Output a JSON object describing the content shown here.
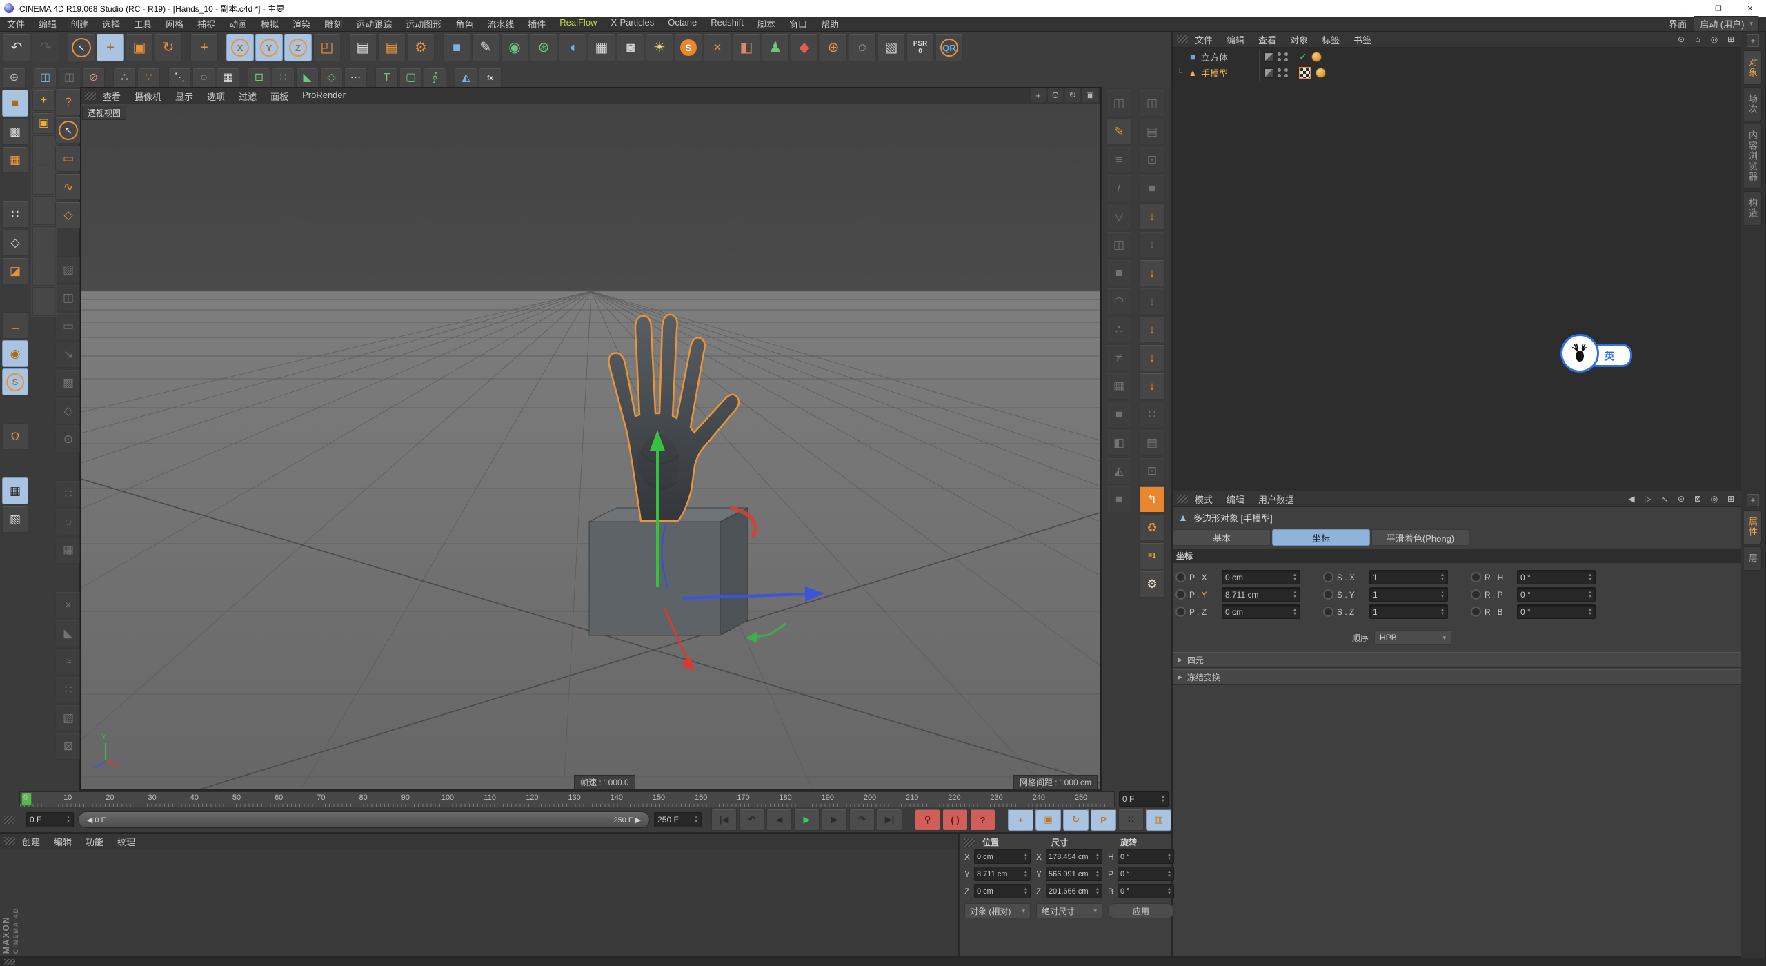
{
  "window": {
    "title": "CINEMA 4D R19.068 Studio (RC - R19) - [Hands_10 - 副本.c4d *] - 主要",
    "controls": [
      {
        "n": "minimize-button",
        "g": "─"
      },
      {
        "n": "maximize-button",
        "g": "❐"
      },
      {
        "n": "close-button",
        "g": "✕"
      }
    ]
  },
  "menubar": {
    "items": [
      "文件",
      "编辑",
      "创建",
      "选择",
      "工具",
      "网格",
      "捕捉",
      "动画",
      "模拟",
      "渲染",
      "雕刻",
      "运动跟踪",
      "运动图形",
      "角色",
      "流水线",
      "插件",
      "RealFlow",
      "X-Particles",
      "Octane",
      "Redshift",
      "脚本",
      "窗口",
      "帮助"
    ],
    "active": "RealFlow",
    "right_label": "界面",
    "layout_dropdown": "启动 (用户)",
    "accent_realflow": "#c8d94a"
  },
  "toolbar_main": [
    {
      "n": "undo-icon",
      "g": "↶",
      "c": "#d8d8d8"
    },
    {
      "n": "redo-icon",
      "g": "↷",
      "c": "#9a9a9a",
      "s": "dis"
    },
    {
      "sep": true
    },
    {
      "n": "live-selection-icon",
      "g": "↖",
      "c": "#e8e8e8",
      "s": "ring"
    },
    {
      "n": "move-tool-icon",
      "g": "+",
      "c": "#b06a10",
      "s": "active"
    },
    {
      "n": "scale-tool-icon",
      "g": "▣",
      "c": "#e8933c"
    },
    {
      "n": "rotate-tool-icon",
      "g": "↻",
      "c": "#e8933c"
    },
    {
      "sep": true
    },
    {
      "n": "last-tool-move-icon",
      "g": "+",
      "c": "#e8933c"
    },
    {
      "sep": true
    },
    {
      "n": "lock-x-axis-icon",
      "g": "X",
      "s": "circ active"
    },
    {
      "n": "lock-y-axis-icon",
      "g": "Y",
      "s": "circ active"
    },
    {
      "n": "lock-z-axis-icon",
      "g": "Z",
      "s": "circ active"
    },
    {
      "n": "coordinate-system-icon",
      "g": "◰",
      "c": "#e8933c"
    },
    {
      "sep": true
    },
    {
      "n": "render-view-icon",
      "g": "▤",
      "c": "#d8d8d8"
    },
    {
      "n": "render-picture-viewer-icon",
      "g": "▤",
      "c": "#e8933c"
    },
    {
      "n": "render-settings-icon",
      "g": "⚙",
      "c": "#e8933c"
    },
    {
      "sep": true
    },
    {
      "n": "primitive-cube-icon",
      "g": "■",
      "c": "#7db2e8"
    },
    {
      "n": "pen-spline-icon",
      "g": "✎",
      "c": "#d8d8d8"
    },
    {
      "n": "subdivision-surface-icon",
      "g": "◉",
      "c": "#6ec47a"
    },
    {
      "n": "cloner-icon",
      "g": "⊛",
      "c": "#6ec47a"
    },
    {
      "n": "spline-deformer-icon",
      "g": "◖",
      "c": "#7db2e8"
    },
    {
      "n": "floor-object-icon",
      "g": "▦",
      "c": "#cfcfcf"
    },
    {
      "n": "camera-object-icon",
      "g": "◙",
      "c": "#d0d0d0"
    },
    {
      "n": "light-object-icon",
      "g": "☀",
      "c": "#f0d070"
    },
    {
      "n": "sky-object-icon",
      "g": "S",
      "s": "orb"
    },
    {
      "n": "particle-emitter-icon",
      "g": "×",
      "c": "#e8933c"
    },
    {
      "n": "motion-clip-icon",
      "g": "◧",
      "c": "#d88a6a"
    },
    {
      "n": "character-object-icon",
      "g": "♟",
      "c": "#6ec47a"
    },
    {
      "n": "joint-tool-icon",
      "g": "◆",
      "c": "#e05d50"
    },
    {
      "n": "geo-sphere-icon",
      "g": "⊕",
      "c": "#e8933c"
    },
    {
      "n": "selection-filter-icon",
      "g": "◌",
      "c": "#cfcfcf"
    },
    {
      "n": "annotation-icon",
      "g": "▧",
      "c": "#cfcfcf"
    },
    {
      "n": "reset-psr-button",
      "g": "PSR\n0",
      "s": "txt"
    },
    {
      "n": "qr-plugin-icon",
      "g": "QR",
      "c": "#7db2e8",
      "s": "circ"
    }
  ],
  "toolbar_second": [
    {
      "n": "earth-icon",
      "g": "⊕",
      "c": "#b8b8b8"
    },
    {
      "sep": true
    },
    {
      "n": "array-axis-icon",
      "g": "◫",
      "c": "#7db2e8"
    },
    {
      "n": "array-axis-disabled-icon",
      "g": "◫",
      "s": "dis"
    },
    {
      "n": "symmetry-points-icon",
      "g": "⊘",
      "c": "#d8907a"
    },
    {
      "sep": true
    },
    {
      "n": "arc-points-icon",
      "g": "∴",
      "c": "#d8d8d8"
    },
    {
      "n": "brush-points-icon",
      "g": "∵",
      "c": "#e8933c"
    },
    {
      "sep": true
    },
    {
      "n": "spline-points-icon",
      "g": "⋱",
      "c": "#d8d8d8"
    },
    {
      "n": "circle-points-icon",
      "g": "◌",
      "c": "#d8d8d8"
    },
    {
      "n": "grid-points-icon",
      "g": "▦",
      "c": "#d8d8d8"
    },
    {
      "sep": true
    },
    {
      "n": "lattice-icon",
      "g": "⊡",
      "c": "#6ec47a"
    },
    {
      "n": "cluster-icon",
      "g": "∷",
      "c": "#6ec47a"
    },
    {
      "n": "shard-icon",
      "g": "◣",
      "c": "#6ec47a"
    },
    {
      "n": "polyhedron-icon",
      "g": "◇",
      "c": "#6ec47a"
    },
    {
      "n": "path-points-icon",
      "g": "⋯",
      "c": "#d8d8d8"
    },
    {
      "sep": true
    },
    {
      "n": "text-object-icon",
      "g": "T",
      "c": "#6ec47a"
    },
    {
      "n": "extrude-cube-icon",
      "g": "▢",
      "c": "#6ec47a"
    },
    {
      "n": "ornament-icon",
      "g": "∮",
      "c": "#6ec47a"
    },
    {
      "sep": true
    },
    {
      "n": "fan-cone-icon",
      "g": "◭",
      "c": "#7db2e8"
    },
    {
      "n": "fx-icon",
      "g": "fx",
      "s": "txt",
      "c": "#e8e8e8"
    }
  ],
  "left_modes": [
    {
      "n": "model-mode-icon",
      "g": "■",
      "c": "#b06a10",
      "s": "active"
    },
    {
      "n": "texture-mode-icon",
      "g": "▩",
      "c": "#d8d8d8"
    },
    {
      "n": "workplane-mode-icon",
      "g": "▦",
      "c": "#e8933c"
    },
    {
      "sep": true
    },
    {
      "n": "points-mode-icon",
      "g": "∷",
      "c": "#d8d8d8"
    },
    {
      "n": "edges-mode-icon",
      "g": "◇",
      "c": "#d8d8d8"
    },
    {
      "n": "polygons-mode-icon",
      "g": "◪",
      "c": "#e8933c"
    },
    {
      "sep": true
    },
    {
      "n": "axis-mode-icon",
      "g": "∟",
      "c": "#e8933c"
    },
    {
      "n": "enable-axis-icon",
      "g": "◉",
      "c": "#b06a10",
      "s": "active"
    },
    {
      "n": "solo-mode-icon",
      "g": "S",
      "s": "circ active"
    },
    {
      "sep": true
    },
    {
      "n": "snap-magnet-icon",
      "g": "Ω",
      "c": "#e8933c"
    },
    {
      "sep": true
    },
    {
      "n": "quantize-grid-icon",
      "g": "▦",
      "c": "#2f2f2f",
      "s": "active"
    },
    {
      "n": "workplane-snap-icon",
      "g": "▧",
      "c": "#d8d8d8"
    }
  ],
  "palette_column": [
    {
      "n": "palette-move-icon",
      "g": "+",
      "c": "#f0b030"
    },
    {
      "n": "palette-scale-icon",
      "g": "▣",
      "c": "#f0b030"
    },
    {
      "n": "palette-empty-slot",
      "s": "empty"
    },
    {
      "n": "palette-empty-slot",
      "s": "empty"
    },
    {
      "n": "palette-empty-slot",
      "s": "empty"
    },
    {
      "n": "palette-empty-slot",
      "s": "empty"
    },
    {
      "n": "palette-empty-slot",
      "s": "empty"
    },
    {
      "n": "palette-empty-slot",
      "s": "empty"
    }
  ],
  "selection_tools": [
    {
      "n": "help-icon",
      "g": "?",
      "c": "#e8833c"
    },
    {
      "n": "pick-live-selection-icon",
      "g": "↖",
      "c": "#e8e8e8",
      "s": "ring"
    },
    {
      "n": "rectangle-selection-icon",
      "g": "▭",
      "c": "#e8933c"
    },
    {
      "n": "lasso-selection-icon",
      "g": "∿",
      "c": "#e8933c"
    },
    {
      "n": "polygon-selection-icon",
      "g": "◇",
      "c": "#e8933c"
    },
    {
      "sep": true
    },
    {
      "n": "modeling-command-icon",
      "g": "▨",
      "s": "dis"
    },
    {
      "n": "modeling-command-icon",
      "g": "◫",
      "s": "dis"
    },
    {
      "n": "modeling-command-icon",
      "g": "▭",
      "s": "dis"
    },
    {
      "n": "modeling-command-icon",
      "g": "↘",
      "s": "dis"
    },
    {
      "n": "modeling-command-icon",
      "g": "▩",
      "s": "dis"
    },
    {
      "n": "modeling-command-icon",
      "g": "◇",
      "s": "dis"
    },
    {
      "n": "modeling-command-icon",
      "g": "⊙",
      "s": "dis"
    },
    {
      "sep": true
    },
    {
      "n": "modeling-command-icon",
      "g": "∷",
      "s": "dis"
    },
    {
      "n": "modeling-command-icon",
      "g": "◌",
      "s": "dis"
    },
    {
      "n": "modeling-command-icon",
      "g": "▦",
      "s": "dis"
    },
    {
      "sep": true
    },
    {
      "n": "modeling-command-icon",
      "g": "×",
      "s": "dis"
    },
    {
      "n": "modeling-command-icon",
      "g": "◣",
      "s": "dis"
    },
    {
      "n": "modeling-command-icon",
      "g": "≈",
      "s": "dis"
    },
    {
      "n": "modeling-command-icon",
      "g": "∷",
      "s": "dis"
    },
    {
      "n": "modeling-command-icon",
      "g": "▧",
      "s": "dis"
    },
    {
      "n": "modeling-command-icon",
      "g": "⊠",
      "s": "dis"
    }
  ],
  "right_strip_a": [
    {
      "n": "edge-cut-icon",
      "g": "◫",
      "s": "dis"
    },
    {
      "n": "pen-tool-icon",
      "g": "✎",
      "c": "#e8933c"
    },
    {
      "n": "stairs-icon",
      "g": "≡",
      "s": "dis"
    },
    {
      "n": "knife-icon",
      "g": "/",
      "s": "dis"
    },
    {
      "n": "cone-wire-icon",
      "g": "▽",
      "s": "dis"
    },
    {
      "n": "cube-stack-icon",
      "g": "◫",
      "s": "dis"
    },
    {
      "n": "solid-cube-icon",
      "g": "■",
      "s": "dis"
    },
    {
      "n": "arch-icon",
      "g": "◠",
      "s": "dis"
    },
    {
      "n": "scatter-icon",
      "g": "∴",
      "s": "dis"
    },
    {
      "n": "track-switch-icon",
      "g": "≠",
      "s": "dis"
    },
    {
      "n": "grid-plane-icon",
      "g": "▦",
      "s": "dis"
    },
    {
      "n": "cube-a-icon",
      "g": "■",
      "s": "dis"
    },
    {
      "n": "cube-b-icon",
      "g": "◧",
      "s": "dis"
    },
    {
      "n": "fan-icon",
      "g": "◭",
      "s": "dis"
    },
    {
      "n": "cube-c-icon",
      "g": "■",
      "s": "dis"
    }
  ],
  "right_strip_b": [
    {
      "n": "cubes-icon",
      "g": "◫",
      "s": "dis"
    },
    {
      "n": "slabs-icon",
      "g": "▤",
      "s": "dis"
    },
    {
      "n": "cube-dots-icon",
      "g": "⊡",
      "s": "dis"
    },
    {
      "n": "cube-d-icon",
      "g": "■",
      "s": "dis"
    },
    {
      "n": "subdivide-icon",
      "g": "↓",
      "c": "#e8933c"
    },
    {
      "n": "subdivide-disabled-icon",
      "g": "↓",
      "s": "dis"
    },
    {
      "n": "untriangulate-icon",
      "g": "↓",
      "c": "#e8933c"
    },
    {
      "n": "triangulate-disabled-icon",
      "g": "↓",
      "s": "dis"
    },
    {
      "n": "subdivide-settings-icon",
      "g": "↓",
      "c": "#e8933c"
    },
    {
      "n": "melt-icon",
      "g": "↓",
      "c": "#e8933c"
    },
    {
      "n": "optimize-settings-icon",
      "g": "↓",
      "c": "#e8933c"
    },
    {
      "n": "dots-options-icon",
      "g": "∷",
      "s": "dis"
    },
    {
      "n": "slabs2-icon",
      "g": "▤",
      "s": "dis"
    },
    {
      "n": "cube-dot-icon",
      "g": "⊡",
      "s": "dis"
    },
    {
      "n": "swap-icon",
      "g": "↰",
      "s": "obox"
    },
    {
      "n": "recycle-icon",
      "g": "♻",
      "c": "#e8933c"
    },
    {
      "n": "reset-scale-icon",
      "g": "=1",
      "s": "txt",
      "c": "#f0b030"
    },
    {
      "n": "settings-cube-icon",
      "g": "⚙",
      "c": "#e8d8c8"
    }
  ],
  "viewport": {
    "menu": [
      "查看",
      "摄像机",
      "显示",
      "选项",
      "过滤",
      "面板",
      "ProRender"
    ],
    "corner_icons": [
      {
        "n": "pan-view-icon",
        "g": "+"
      },
      {
        "n": "zoom-view-icon",
        "g": "⊙"
      },
      {
        "n": "rotate-view-icon",
        "g": "↻"
      },
      {
        "n": "toggle-view-icon",
        "g": "▣"
      }
    ],
    "view_label": "透视视图",
    "framerate": "帧速 : 1000.0",
    "grid_spacing": "网格间距 : 1000 cm",
    "axis_labels": {
      "y": "Y"
    }
  },
  "object_manager": {
    "menu": [
      "文件",
      "编辑",
      "查看",
      "对象",
      "标签",
      "书签"
    ],
    "icons": [
      {
        "n": "search-icon",
        "g": "⊙"
      },
      {
        "n": "path-up-icon",
        "g": "⌂"
      },
      {
        "n": "filter-icon",
        "g": "◎"
      },
      {
        "n": "add-panel-icon",
        "g": "⊞"
      }
    ],
    "objects": [
      {
        "name": "立方体",
        "g": "■",
        "c": "#6fa3e0",
        "selected": false,
        "tags": [
          "check",
          "phong"
        ]
      },
      {
        "name": "手模型",
        "g": "▲",
        "c": "#e8b060",
        "selected": true,
        "tags": [
          "texture",
          "phong"
        ]
      }
    ],
    "side_tabs": [
      {
        "label": "对象",
        "active": true
      },
      {
        "label": "场次",
        "active": false
      },
      {
        "label": "内容浏览器",
        "active": false
      },
      {
        "label": "构造",
        "active": false
      }
    ]
  },
  "attribute_manager": {
    "menu": [
      "模式",
      "编辑",
      "用户数据"
    ],
    "icons": [
      {
        "n": "history-back-icon",
        "g": "◀"
      },
      {
        "n": "history-forward-icon",
        "g": "▷",
        "s": "dis"
      },
      {
        "n": "pick-icon",
        "g": "↖"
      },
      {
        "n": "find-icon",
        "g": "⊙"
      },
      {
        "n": "lock-icon",
        "g": "⊠"
      },
      {
        "n": "track-target-icon",
        "g": "◎"
      },
      {
        "n": "new-panel-icon",
        "g": "⊞"
      }
    ],
    "object_title": "多边形对象 [手模型]",
    "tabs": [
      "基本",
      "坐标",
      "平滑着色(Phong)"
    ],
    "active_tab_index": 1,
    "section_title": "坐标",
    "rows": [
      [
        {
          "k": "p-x",
          "l": "P . X",
          "v": "0 cm"
        },
        {
          "k": "s-x",
          "l": "S . X",
          "v": "1"
        },
        {
          "k": "r-h",
          "l": "R . H",
          "v": "0 °"
        }
      ],
      [
        {
          "k": "p-y",
          "l": "P . Y",
          "v": "8.711 cm",
          "hl": true
        },
        {
          "k": "s-y",
          "l": "S . Y",
          "v": "1"
        },
        {
          "k": "r-p",
          "l": "R . P",
          "v": "0 °"
        }
      ],
      [
        {
          "k": "p-z",
          "l": "P . Z",
          "v": "0 cm"
        },
        {
          "k": "s-z",
          "l": "S . Z",
          "v": "1"
        },
        {
          "k": "r-b",
          "l": "R . B",
          "v": "0 °"
        }
      ]
    ],
    "order_label": "顺序",
    "order_value": "HPB",
    "collapsed_sections": [
      "四元",
      "冻结变换"
    ],
    "side_tabs": [
      {
        "label": "属性",
        "active": true
      },
      {
        "label": "层",
        "active": false
      }
    ]
  },
  "timeline": {
    "ticks": [
      0,
      10,
      20,
      30,
      40,
      50,
      60,
      70,
      80,
      90,
      100,
      110,
      120,
      130,
      140,
      150,
      160,
      170,
      180,
      190,
      200,
      210,
      220,
      230,
      240,
      250
    ],
    "end_spinner": "0 F",
    "current": "0 F",
    "range_start": "0 F",
    "range_end": "250 F",
    "range_end_value": "250 F",
    "transport": [
      {
        "n": "goto-start-button",
        "g": "|◀"
      },
      {
        "n": "prev-key-button",
        "g": "↶"
      },
      {
        "n": "prev-frame-button",
        "g": "◀"
      },
      {
        "n": "play-forward-button",
        "g": "▶",
        "s": "green"
      },
      {
        "n": "next-frame-button",
        "g": "▶"
      },
      {
        "n": "next-key-button",
        "g": "↷"
      },
      {
        "n": "goto-end-button",
        "g": "▶|"
      }
    ],
    "record": [
      {
        "n": "record-keyframe-button",
        "g": "⚲",
        "s": "red"
      },
      {
        "n": "autokey-button",
        "g": "( )",
        "s": "red"
      },
      {
        "n": "keyframe-selection-button",
        "g": "?",
        "s": "red"
      }
    ],
    "keyframe_toggles": [
      {
        "n": "keyframe-position-toggle",
        "g": "+",
        "s": "bluebg"
      },
      {
        "n": "keyframe-scale-toggle",
        "g": "▣",
        "s": "bluebg"
      },
      {
        "n": "keyframe-rotation-toggle",
        "g": "↻",
        "s": "bluebg"
      },
      {
        "n": "keyframe-parameter-toggle",
        "g": "P",
        "s": "bluebg"
      },
      {
        "n": "keyframe-pla-toggle",
        "g": "∷"
      },
      {
        "n": "minimal-timeline-toggle",
        "g": "▥",
        "s": "bluebg"
      }
    ]
  },
  "material_manager": {
    "menu": [
      "创建",
      "编辑",
      "功能",
      "纹理"
    ]
  },
  "coordinates_panel": {
    "groups": [
      {
        "title": "位置",
        "rows": [
          {
            "l": "X",
            "v": "0 cm"
          },
          {
            "l": "Y",
            "v": "8.711 cm"
          },
          {
            "l": "Z",
            "v": "0 cm"
          }
        ],
        "footer": {
          "type": "dropdown",
          "label": "对象 (相对)",
          "n": "position-mode-dropdown"
        }
      },
      {
        "title": "尺寸",
        "rows": [
          {
            "l": "X",
            "v": "178.454 cm"
          },
          {
            "l": "Y",
            "v": "566.091 cm"
          },
          {
            "l": "Z",
            "v": "201.666 cm"
          }
        ],
        "footer": {
          "type": "dropdown",
          "label": "绝对尺寸",
          "n": "size-mode-dropdown"
        }
      },
      {
        "title": "旋转",
        "rows": [
          {
            "l": "H",
            "v": "0 °"
          },
          {
            "l": "P",
            "v": "0 °"
          },
          {
            "l": "B",
            "v": "0 °"
          }
        ],
        "footer": {
          "type": "button",
          "label": "应用",
          "n": "apply-button"
        }
      }
    ]
  },
  "ime": {
    "mode": "英"
  },
  "brand": {
    "line1": "MAXON",
    "line2": "CINEMA 4D"
  }
}
